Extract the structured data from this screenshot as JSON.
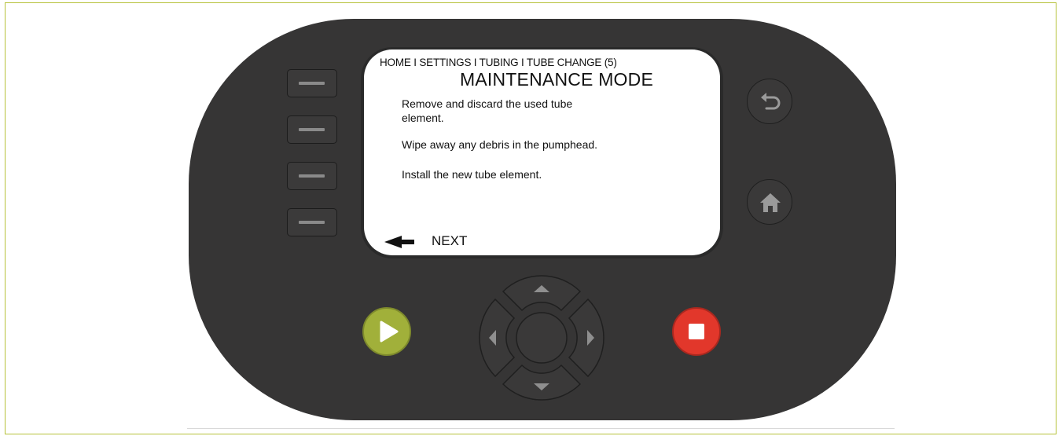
{
  "screen": {
    "breadcrumb": "HOME I SETTINGS I TUBING I TUBE CHANGE (5)",
    "title": "MAINTENANCE MODE",
    "instructions": [
      "Remove and discard the used tube element.",
      "Wipe away any debris in the pumphead.",
      "Install the new tube element."
    ],
    "next_label": "NEXT"
  },
  "colors": {
    "device_body": "#363535",
    "start_button": "#a1b03a",
    "stop_button": "#e2372b",
    "frame_border": "#b6c23a"
  },
  "icons": {
    "back": "back-arrow-icon",
    "home": "home-icon",
    "start": "play-icon",
    "stop": "stop-icon",
    "next": "left-arrow-icon"
  }
}
